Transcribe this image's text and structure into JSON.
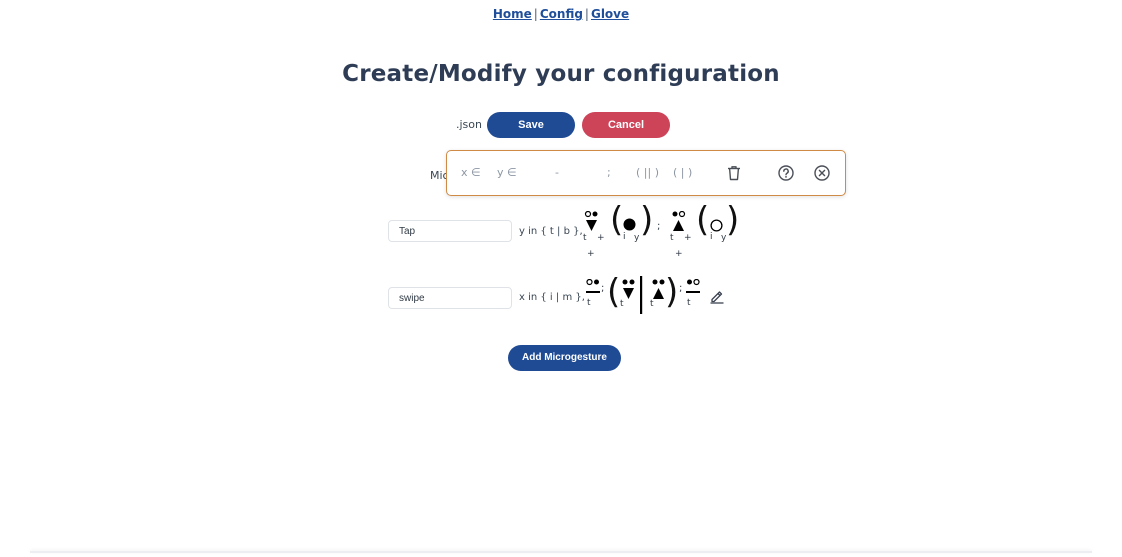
{
  "nav": {
    "home": "Home",
    "config": "Config",
    "glove": "Glove",
    "separator": "|"
  },
  "page_title": "Create/Modify your configuration",
  "toolbar_row": {
    "json_label": ".json",
    "save_label": "Save",
    "cancel_label": "Cancel"
  },
  "editor": {
    "row_label_partial": "Mic",
    "x_in": "x ∈",
    "y_in": "y ∈",
    "dash": "-",
    "semicolon": ";",
    "parallel": "( || )",
    "single_bar": "( | )",
    "icons": [
      "trash-icon",
      "help-icon",
      "close-circle-icon"
    ]
  },
  "microgestures": [
    {
      "name": "Tap",
      "domain": "y in { t | b },",
      "symbol_sub_t": "t",
      "symbol_sub_plus": "+",
      "symbol_sub_i": "i",
      "symbol_sub_y": "y",
      "semicolon": ";"
    },
    {
      "name": "swipe",
      "domain": "x in { i | m },",
      "symbol_sub_t": "t",
      "semicolon": ";"
    }
  ],
  "add_button_label": "Add Microgesture",
  "colors": {
    "primary": "#1f4a94",
    "danger": "#cd4358",
    "editor_border": "#cf8b46",
    "title": "#2e3d55"
  }
}
